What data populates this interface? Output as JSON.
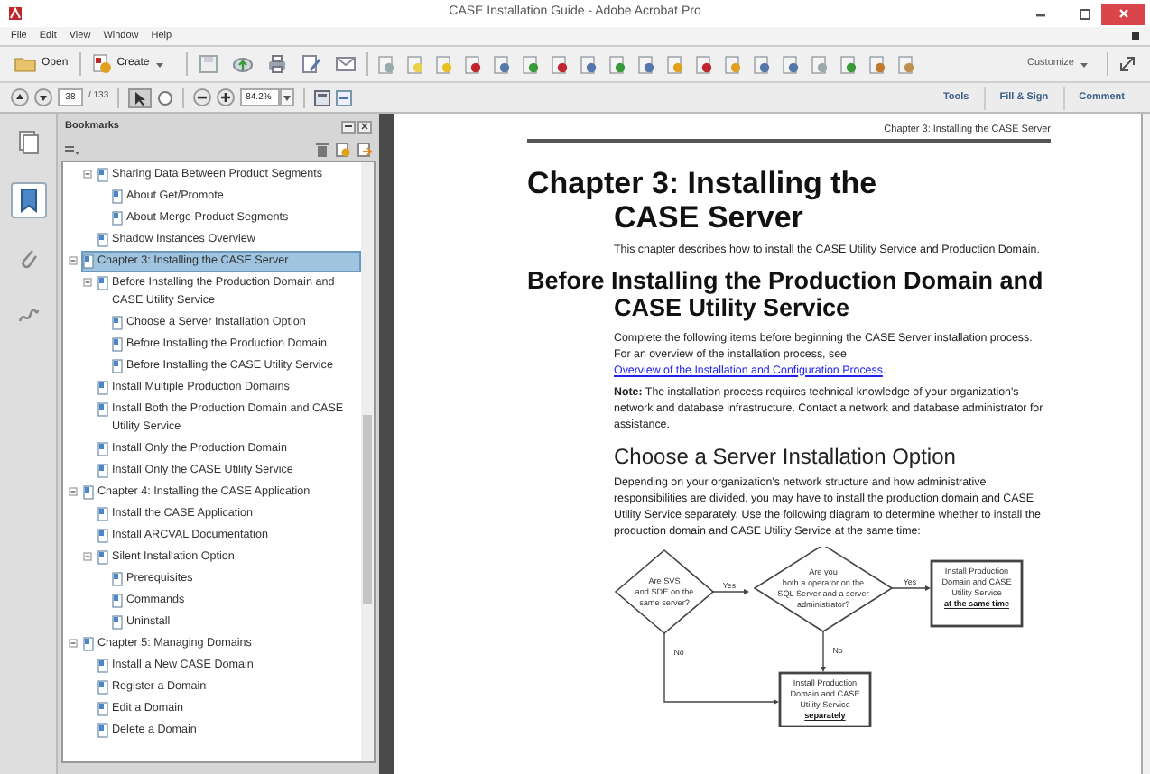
{
  "window": {
    "title": "CASE Installation Guide - Adobe Acrobat Pro"
  },
  "menu": [
    "File",
    "Edit",
    "View",
    "Window",
    "Help"
  ],
  "toolbar": {
    "open": "Open",
    "create": "Create",
    "customize": "Customize"
  },
  "navigation": {
    "page": "38",
    "page_count": "/ 133",
    "zoom": "84.2%"
  },
  "panes": [
    "Tools",
    "Fill & Sign",
    "Comment"
  ],
  "side_tabs": [
    {
      "kind": "pages",
      "selected": false
    },
    {
      "kind": "bookmarks",
      "selected": true
    },
    {
      "kind": "attachments",
      "selected": false
    },
    {
      "kind": "signatures",
      "selected": false
    }
  ],
  "bookmarks": {
    "title": "Bookmarks",
    "continued": [
      {
        "label": "Sharing Data Between Product Segments",
        "selected": false,
        "expanded": true,
        "children": [
          {
            "label": "About Get/Promote",
            "selected": false
          },
          {
            "label": "About Merge Product Segments",
            "selected": false
          }
        ]
      },
      {
        "label": "Shadow Instances Overview",
        "selected": false
      }
    ],
    "items": [
      {
        "label": "Chapter 3: Installing the CASE Server",
        "selected": true,
        "expanded": true,
        "children": [
          {
            "label": "Before Installing the Production Domain and CASE Utility Service",
            "selected": false,
            "expanded": true,
            "children": [
              {
                "label": "Choose a Server Installation Option",
                "selected": false
              },
              {
                "label": "Before Installing the Production Domain",
                "selected": false
              },
              {
                "label": "Before Installing the CASE Utility Service",
                "selected": false
              }
            ]
          },
          {
            "label": "Install Multiple Production Domains",
            "selected": false
          },
          {
            "label": "Install Both the Production Domain and CASE Utility Service",
            "selected": false
          },
          {
            "label": "Install Only the Production Domain",
            "selected": false
          },
          {
            "label": "Install Only the CASE Utility Service",
            "selected": false
          }
        ]
      },
      {
        "label": "Chapter 4: Installing the CASE Application",
        "selected": false,
        "expanded": true,
        "children": [
          {
            "label": "Install the CASE Application",
            "selected": false
          },
          {
            "label": "Install ARCVAL Documentation",
            "selected": false
          },
          {
            "label": "Silent Installation Option",
            "selected": false,
            "expanded": true,
            "children": [
              {
                "label": "Prerequisites",
                "selected": false
              },
              {
                "label": "Commands",
                "selected": false
              },
              {
                "label": "Uninstall",
                "selected": false
              }
            ]
          }
        ]
      },
      {
        "label": "Chapter 5: Managing Domains",
        "selected": false,
        "expanded": true,
        "children": [
          {
            "label": "Install a New CASE Domain",
            "selected": false
          },
          {
            "label": "Register a Domain",
            "selected": false
          },
          {
            "label": "Edit a Domain",
            "selected": false
          },
          {
            "label": "Delete a Domain",
            "selected": false
          }
        ]
      }
    ]
  },
  "page": {
    "running_head": "Chapter 3:  Installing the CASE Server",
    "title_lines": [
      "Chapter 3:  Installing the",
      "CASE Server"
    ],
    "intro": "This chapter describes how to install the CASE Utility Service and Production Domain.",
    "section_lines": [
      "Before Installing the Production Domain and",
      "CASE Utility Service"
    ],
    "section_text": "Complete the following items before beginning the CASE Server installation process. For an overview of the installation process, see",
    "section_link": "Overview of the Installation and Configuration Process",
    "section_end": ".",
    "note": "**Note:** The installation process requires technical knowledge of your organization's network and database infrastructure. Contact a network and database administrator for assistance.",
    "subsection": "Choose a Server Installation Option",
    "subsection_text": "Depending on your organization's network structure and how administrative responsibilities are divided, you may have to install the production domain and CASE Utility Service separately.  Use the following diagram to determine whether to install the production domain and CASE Utility Service at the same time:",
    "diagram": {
      "nodes": [
        {
          "kind": "decision",
          "lines": [
            "Are SVS",
            "and SDE on the",
            "same server?"
          ]
        },
        {
          "kind": "decision",
          "lines": [
            "Are you",
            "both a operator on the",
            "SQL Server and a server",
            "administrator?"
          ]
        },
        {
          "kind": "process",
          "lines": [
            "Install Production",
            "Domain and CASE",
            "Utility Service"
          ],
          "emphasis": "at the same time"
        },
        {
          "kind": "process",
          "lines": [
            "Install Production",
            "Domain and CASE",
            "Utility Service"
          ],
          "emphasis": "separately"
        }
      ],
      "labels": [
        "Yes",
        "Yes",
        "No",
        "No"
      ]
    }
  }
}
